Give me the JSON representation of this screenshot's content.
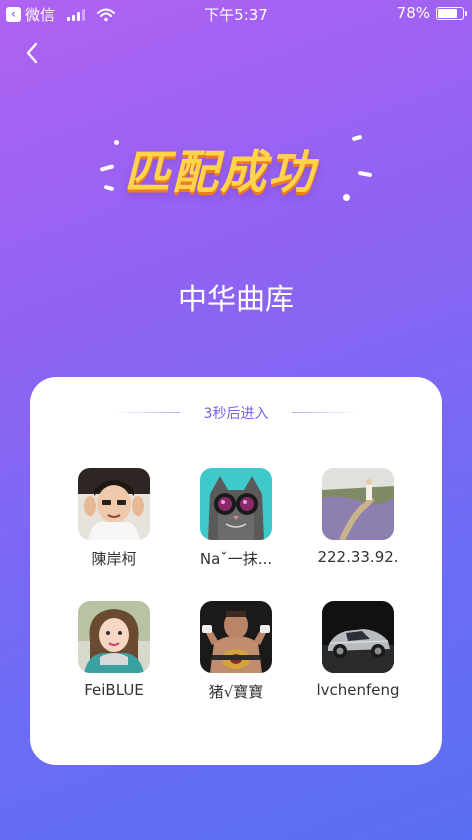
{
  "status_bar": {
    "back_app": "微信",
    "time": "下午5:37",
    "battery": "78%",
    "battery_level": 0.78
  },
  "header": {
    "back_icon": "chevron-left-icon",
    "match_title": "匹配成功"
  },
  "library": {
    "name": "中华曲库"
  },
  "card": {
    "countdown": "3秒后进入",
    "members": [
      {
        "name": "陳岸柯",
        "avatar": "avatar-photo-boy"
      },
      {
        "name": "Naˇ一抹...",
        "avatar": "avatar-photo-cat-goggles"
      },
      {
        "name": "222.33.92.",
        "avatar": "avatar-photo-field"
      },
      {
        "name": "FeiBLUE",
        "avatar": "avatar-photo-girl"
      },
      {
        "name": "猪√寶寶",
        "avatar": "avatar-photo-wrestler"
      },
      {
        "name": "lvchenfeng",
        "avatar": "avatar-photo-car"
      }
    ]
  },
  "colors": {
    "accent": "#7a5ef0",
    "title_gold": "#ffd34a",
    "title_shadow": "#f07a1e"
  }
}
